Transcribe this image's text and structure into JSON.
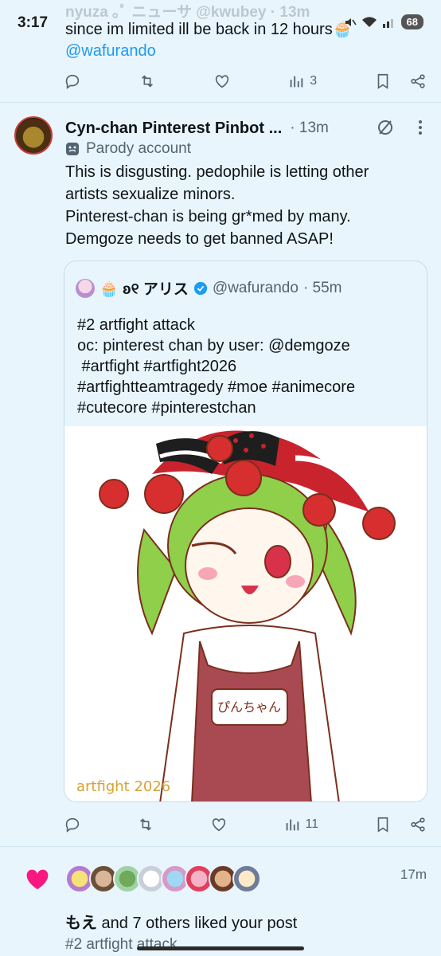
{
  "status": {
    "time": "3:17",
    "battery": "68"
  },
  "prev_tweet": {
    "header_faded": "nyuza ｡ﾟ ニューサ @kwubey · 13m",
    "text": "since im limited ill be back in 12 hours🧁",
    "mention": "@wafurando",
    "views": "3"
  },
  "tweet": {
    "author": "Cyn-chan Pinterest Pinbot ...",
    "time": "· 13m",
    "badge": "Parody account",
    "lines": [
      "This is disgusting. pedophile is letting other",
      "artists sexualize minors.",
      "Pinterest-chan is being gr*med by many.",
      "Demgoze needs to get banned ASAP!"
    ],
    "views": "11"
  },
  "quote": {
    "name": "🧁 ʚ୧ アリス",
    "handle": "@wafurando",
    "time": "· 55m",
    "lines": [
      "#2 artfight attack",
      "oc: pinterest chan by user: @demgoze",
      " #artfight #artfight2026",
      "#artfightteamtragedy #moe #animecore",
      "#cutecore #pinterestchan"
    ],
    "image_cup_text": "ぴんちゃん",
    "image_watermark": "artfight 2026"
  },
  "notification": {
    "time": "17m",
    "liker": "もえ",
    "rest": " and 7 others liked your post",
    "sub": "#2 artfight attack"
  },
  "colors": {
    "accent": "#1d9bf0",
    "heart": "#f91880",
    "bg": "#e8f5fd"
  }
}
